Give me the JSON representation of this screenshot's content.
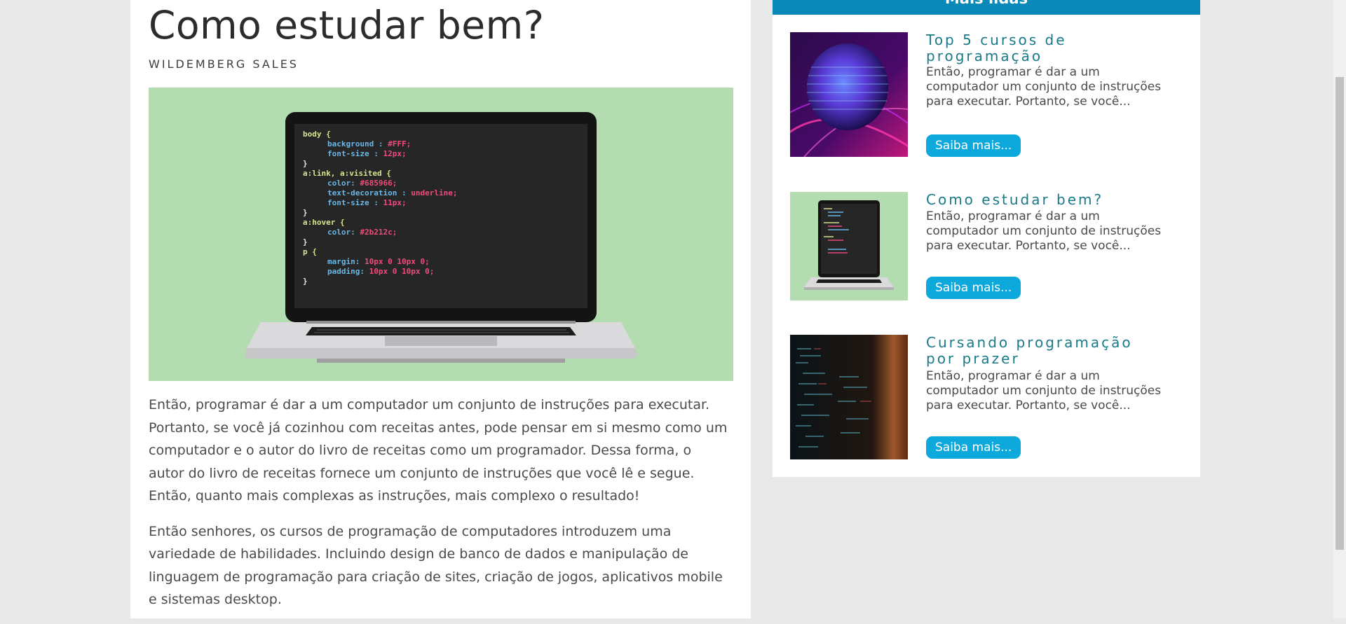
{
  "article": {
    "title": "Como estudar bem?",
    "author": "WILDEMBERG SALES",
    "code_lines": [
      "body {",
      "background : #FFF;",
      "font-size : 12px;",
      "}",
      "a:link, a:visited {",
      "color: #685966;",
      "text-decoration : underline;",
      "font-size : 11px;",
      "}",
      "a:hover {",
      "color: #2b212c;",
      "}",
      "p {",
      "margin: 10px 0 10px 0;",
      "padding: 10px 0 10px 0;",
      "}"
    ],
    "paragraphs": [
      "Então, programar é dar a um computador um conjunto de instruções para executar. Portanto, se você já cozinhou com receitas antes, pode pensar em si mesmo como um computador e o autor do livro de receitas como um programador. Dessa forma, o autor do livro de receitas fornece um conjunto de instruções que você lê e segue. Então, quanto mais complexas as instruções, mais complexo o resultado!",
      "Então senhores, os cursos de programação de computadores introduzem uma variedade de habilidades. Incluindo design de banco de dados e manipulação de linguagem de programação para criação de sites, criação de jogos, aplicativos mobile e sistemas desktop."
    ]
  },
  "sidebar": {
    "title": "Mais lidas",
    "items": [
      {
        "title": "Top 5 cursos de programação",
        "description": "Então, programar é dar a um computador um conjunto de instruções para executar. Portanto, se você...",
        "button": "Saiba mais..."
      },
      {
        "title": "Como estudar bem?",
        "description": "Então, programar é dar a um computador um conjunto de instruções para executar. Portanto, se você...",
        "button": "Saiba mais..."
      },
      {
        "title": "Cursando programação por prazer",
        "description": "Então, programar é dar a um computador um conjunto de instruções para executar. Portanto, se você...",
        "button": "Saiba mais..."
      }
    ]
  },
  "colors": {
    "accent": "#0ea9dc",
    "header": "#0a89b8",
    "title_teal": "#197a89",
    "hero_bg": "#b3dcb0"
  }
}
